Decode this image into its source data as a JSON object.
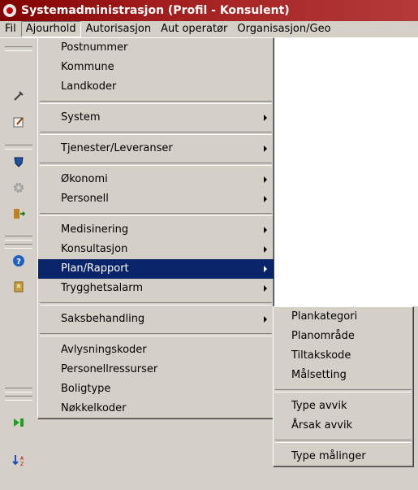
{
  "window": {
    "title": "Systemadministrasjon (Profil - Konsulent)"
  },
  "menubar": [
    "Fil",
    "Ajourhold",
    "Autorisasjon",
    "Aut operatør",
    "Organisasjon/Geo"
  ],
  "menu": {
    "groups": [
      [
        "Postnummer",
        "Kommune",
        "Landkoder"
      ],
      [
        "System"
      ],
      [
        "Tjenester/Leveranser"
      ],
      [
        "Økonomi",
        "Personell"
      ],
      [
        "Medisinering",
        "Konsultasjon",
        "Plan/Rapport",
        "Trygghetsalarm"
      ],
      [
        "Saksbehandling"
      ],
      [
        "Avlysningskoder",
        "Personellressurser",
        "Boligtype",
        "Nøkkelkoder"
      ]
    ],
    "submenu_items": [
      "System",
      "Tjenester/Leveranser",
      "Økonomi",
      "Personell",
      "Medisinering",
      "Konsultasjon",
      "Plan/Rapport",
      "Trygghetsalarm",
      "Saksbehandling"
    ],
    "selected": "Plan/Rapport"
  },
  "submenu": {
    "groups": [
      [
        "Plankategori",
        "Planområde",
        "Tiltakskode",
        "Målsetting"
      ],
      [
        "Type avvik",
        "Årsak avvik"
      ],
      [
        "Type målinger"
      ]
    ]
  },
  "colors": {
    "title_bar": "#8b0000",
    "menu_bg": "#d4d0c8",
    "selection": "#0a246a"
  },
  "toolbar_icons": [
    "tools-icon",
    "edit-icon",
    "shield-icon",
    "gear-icon",
    "exit-icon",
    "help-icon",
    "book-icon",
    "play-icon",
    "sort-icon"
  ]
}
